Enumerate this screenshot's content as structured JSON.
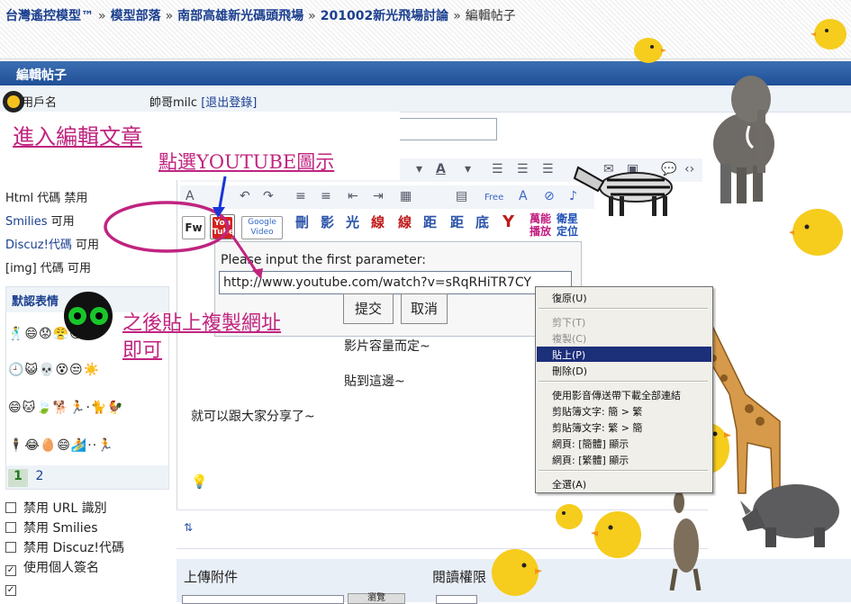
{
  "breadcrumb": [
    "台灣遙控模型™",
    "模型部落",
    "南部高雄新光碼頭飛場",
    "201002新光飛場討論",
    "編輯帖子"
  ],
  "breadcrumb_sep": "»",
  "page_title": "編輯帖子",
  "user_row": {
    "label": "用戶名",
    "username": "帥哥milc",
    "logout": "[退出登錄]"
  },
  "annotations": {
    "step1": "進入編輯文章",
    "step2": "點選YOUTUBE圖示",
    "step3_line1": "之後貼上複製網址",
    "step3_line2": "即可"
  },
  "left_options": [
    {
      "name": "Html 代碼",
      "state": "禁用"
    },
    {
      "name": "Smilies",
      "state": "可用"
    },
    {
      "name": "Discuz!代碼",
      "state": "可用"
    },
    {
      "name": "[img] 代碼",
      "state": "可用"
    }
  ],
  "smilies": {
    "title": "默認表情",
    "rows": [
      "🕺😄😟😤😊",
      "🕘😺💀😵😒☀️",
      "😄🐱🍃🐕🏃·🐈🐓",
      "🕴😂🥚😄🏄··🏃"
    ],
    "pages": [
      "1",
      "2"
    ]
  },
  "checkboxes": [
    {
      "label": "禁用 URL 識別",
      "checked": false
    },
    {
      "label": "禁用 Smilies",
      "checked": false
    },
    {
      "label": "禁用 Discuz!代碼",
      "checked": false
    },
    {
      "label": "使用個人簽名",
      "checked": true
    },
    {
      "label": "",
      "checked": true
    }
  ],
  "toolbar": {
    "free_label": "Free",
    "fw_label": "Fw",
    "youtube_label": "You Tube",
    "google_label": "Google Video"
  },
  "toolbar_ext": [
    "刪",
    "影",
    "光",
    "線",
    "線",
    "距",
    "距",
    "底"
  ],
  "toolbar_ext2": [
    "萬能",
    "播放",
    "衛星",
    "定位"
  ],
  "prompt": {
    "label": "Please input the first parameter:",
    "value": "http://www.youtube.com/watch?v=sRqRHiTR7CY",
    "submit": "提交",
    "cancel": "取消"
  },
  "body_text": [
    "影片容量而定~",
    "貼到這邊~",
    "就可以跟大家分享了~"
  ],
  "context_menu": [
    {
      "label": "復原(U)",
      "state": "normal"
    },
    {
      "label": "剪下(T)",
      "state": "disabled"
    },
    {
      "label": "複製(C)",
      "state": "disabled"
    },
    {
      "label": "貼上(P)",
      "state": "selected"
    },
    {
      "label": "刪除(D)",
      "state": "normal"
    },
    {
      "label": "使用影音傳送帶下載全部連結",
      "state": "normal"
    },
    {
      "label": "剪貼簿文字: 簡 > 繁",
      "state": "normal"
    },
    {
      "label": "剪貼簿文字: 繁 > 簡",
      "state": "normal"
    },
    {
      "label": "網頁: [簡體] 顯示",
      "state": "normal"
    },
    {
      "label": "網頁: [繁體] 顯示",
      "state": "normal"
    },
    {
      "label": "全選(A)",
      "state": "normal"
    }
  ],
  "upload": {
    "title": "上傳附件",
    "permission": "閱讀權限",
    "browse": "瀏覽"
  },
  "colors": {
    "annotation": "#c0247f",
    "title_bar": "#2a5ba3",
    "link": "#1b3f8f",
    "menu_selected": "#1c2f79"
  }
}
